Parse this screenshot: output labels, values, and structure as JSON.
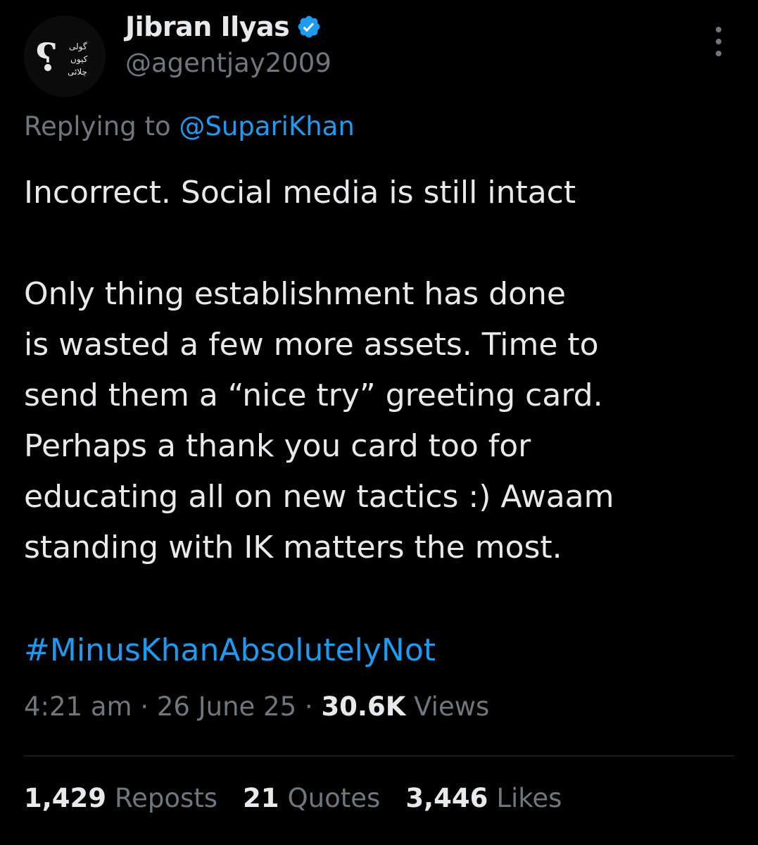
{
  "author": {
    "display_name": "Jibran Ilyas",
    "handle": "@agentjay2009",
    "verified": true,
    "avatar_text": "گولی کیوں چلائی ؟"
  },
  "reply": {
    "prefix": "Replying to",
    "mention": "@SupariKhan"
  },
  "body": {
    "paragraph_1": "Incorrect. Social media is still intact",
    "paragraph_2_lines": [
      "Only thing establishment has done",
      "is wasted a few more assets. Time to",
      "send them a “nice try” greeting card.",
      "Perhaps a thank you card too for",
      "educating all on new tactics :) Awaam",
      "standing with IK matters the most."
    ],
    "hashtag": "#MinusKhanAbsolutelyNot"
  },
  "meta": {
    "time": "4:21 am",
    "separator": "·",
    "date": "26 June 25",
    "views_count": "30.6K",
    "views_label": "Views"
  },
  "stats": {
    "reposts_count": "1,429",
    "reposts_label": "Reposts",
    "quotes_count": "21",
    "quotes_label": "Quotes",
    "likes_count": "3,446",
    "likes_label": "Likes"
  },
  "colors": {
    "background": "#000000",
    "text_primary": "#e7e9ea",
    "text_secondary": "#71767b",
    "accent": "#1d9bf0",
    "divider": "#2f3336"
  },
  "icons": [
    "verified-badge-icon",
    "more-options-icon"
  ]
}
